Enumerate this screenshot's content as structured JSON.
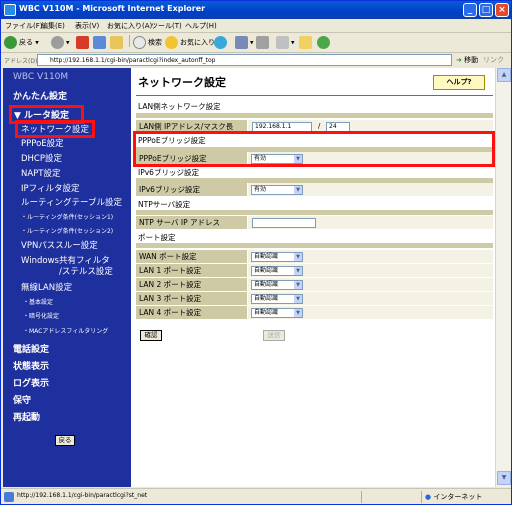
{
  "window": {
    "title": "WBC V110M - Microsoft Internet Explorer"
  },
  "menubar": [
    "ファイル(F)",
    "編集(E)",
    "表示(V)",
    "お気に入り(A)",
    "ツール(T)",
    "ヘルプ(H)"
  ],
  "toolbar": {
    "back": "戻る",
    "search": "検索",
    "favorites": "お気に入り"
  },
  "address": {
    "label": "アドレス(D)",
    "url": "http://192.168.1.1/cgi-bin/paractlcgi?index_autonff_top",
    "go": "移動",
    "links": "リンク"
  },
  "sidebar": {
    "brand": "WBC V110M",
    "easy": "かんたん設定",
    "router": "▼ ルータ設定",
    "network": "ネットワーク設定",
    "pppoe": "PPPoE設定",
    "dhcp": "DHCP設定",
    "napt": "NAPT設定",
    "ipfilter": "IPフィルタ設定",
    "routing": "ルーティングテーブル設定",
    "session1": "・ルーティング条件(セッション1)",
    "session2": "・ルーティング条件(セッション2)",
    "vpn": "VPNパススルー設定",
    "winshare1": "Windows共有フィルタ",
    "winshare2": "/ステルス設定",
    "wlan": "無線LAN設定",
    "wlan_basic": "・基本設定",
    "wlan_crypto": "・暗号化設定",
    "wlan_mac": "・MACアドレスフィルタリング",
    "phone": "電話設定",
    "status": "状態表示",
    "log": "ログ表示",
    "maint": "保守",
    "reboot": "再起動",
    "back_btn": "戻る"
  },
  "main": {
    "title": "ネットワーク設定",
    "help": "ヘルプ?",
    "lan_section": "LAN側ネットワーク設定",
    "lan_ip_label": "LAN側 IPアドレス/マスク長",
    "lan_ip": "192.168.1.1",
    "lan_slash": "/",
    "lan_mask": "24",
    "pppoe_section": "PPPoEブリッジ設定",
    "pppoe_label": "PPPoEブリッジ設定",
    "pppoe_value": "有効",
    "ipv6_section": "IPv6ブリッジ設定",
    "ipv6_label": "IPv6ブリッジ設定",
    "ipv6_value": "有効",
    "ntp_section": "NTPサーバ設定",
    "ntp_label": "NTP サーバ IP アドレス",
    "ntp_value": "",
    "port_section": "ポート設定",
    "ports": [
      {
        "label": "WAN ポート設定",
        "value": "自動認識"
      },
      {
        "label": "LAN 1 ポート設定",
        "value": "自動認識"
      },
      {
        "label": "LAN 2 ポート設定",
        "value": "自動認識"
      },
      {
        "label": "LAN 3 ポート設定",
        "value": "自動認識"
      },
      {
        "label": "LAN 4 ポート設定",
        "value": "自動認識"
      }
    ],
    "confirm": "確認",
    "send": "送信"
  },
  "statusbar": {
    "url": "http://192.168.1.1/cgi-bin/paractlcgi?st_net",
    "zone": "インターネット"
  }
}
